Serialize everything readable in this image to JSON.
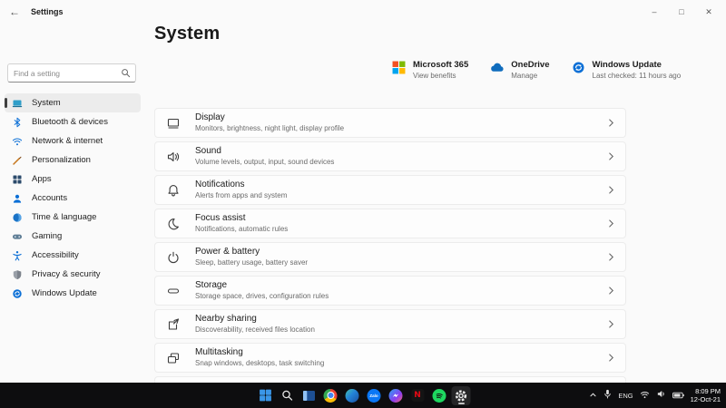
{
  "window": {
    "title": "Settings",
    "back_glyph": "←",
    "controls": {
      "minimize": "–",
      "maximize": "□",
      "close": "✕"
    }
  },
  "sidebar": {
    "search_placeholder": "Find a setting",
    "items": [
      {
        "label": "System",
        "icon": "laptop",
        "selected": true
      },
      {
        "label": "Bluetooth & devices",
        "icon": "bluetooth",
        "selected": false
      },
      {
        "label": "Network & internet",
        "icon": "wifi",
        "selected": false
      },
      {
        "label": "Personalization",
        "icon": "brush",
        "selected": false
      },
      {
        "label": "Apps",
        "icon": "apps-grid",
        "selected": false
      },
      {
        "label": "Accounts",
        "icon": "person",
        "selected": false
      },
      {
        "label": "Time & language",
        "icon": "clock-globe",
        "selected": false
      },
      {
        "label": "Gaming",
        "icon": "gamepad",
        "selected": false
      },
      {
        "label": "Accessibility",
        "icon": "accessibility-person",
        "selected": false
      },
      {
        "label": "Privacy & security",
        "icon": "shield",
        "selected": false
      },
      {
        "label": "Windows Update",
        "icon": "update-arrows",
        "selected": false
      }
    ]
  },
  "main": {
    "page_title": "System",
    "quick_cards": [
      {
        "title": "Microsoft 365",
        "subtitle": "View benefits",
        "icon": "microsoft-logo"
      },
      {
        "title": "OneDrive",
        "subtitle": "Manage",
        "icon": "onedrive-cloud"
      },
      {
        "title": "Windows Update",
        "subtitle": "Last checked: 11 hours ago",
        "icon": "windows-update"
      }
    ],
    "settings_list": [
      {
        "title": "Display",
        "subtitle": "Monitors, brightness, night light, display profile",
        "icon": "display"
      },
      {
        "title": "Sound",
        "subtitle": "Volume levels, output, input, sound devices",
        "icon": "speaker"
      },
      {
        "title": "Notifications",
        "subtitle": "Alerts from apps and system",
        "icon": "bell"
      },
      {
        "title": "Focus assist",
        "subtitle": "Notifications, automatic rules",
        "icon": "moon"
      },
      {
        "title": "Power & battery",
        "subtitle": "Sleep, battery usage, battery saver",
        "icon": "power"
      },
      {
        "title": "Storage",
        "subtitle": "Storage space, drives, configuration rules",
        "icon": "drive"
      },
      {
        "title": "Nearby sharing",
        "subtitle": "Discoverability, received files location",
        "icon": "share"
      },
      {
        "title": "Multitasking",
        "subtitle": "Snap windows, desktops, task switching",
        "icon": "windows-stack"
      }
    ]
  },
  "taskbar": {
    "apps": [
      "start",
      "search",
      "task-view",
      "chrome",
      "edge",
      "zalo",
      "messenger",
      "netflix",
      "spotify",
      "settings"
    ],
    "active_app": "settings",
    "zalo_label": "Zalo",
    "netflix_letter": "N",
    "tray": {
      "language": "ENG",
      "time": "8:09 PM",
      "date": "12-Oct-21"
    }
  },
  "colors": {
    "accent_indicator": "#3f3f3f",
    "selected_item_bg": "#ececec",
    "card_bg": "#fdfdfd",
    "card_border": "#ececec",
    "taskbar_bg": "#0d0d0f",
    "ms_red": "#f25022",
    "ms_green": "#7fba00",
    "ms_blue": "#00a4ef",
    "ms_yellow": "#ffb900",
    "onedrive_blue": "#0f6cbd",
    "update_blue": "#0b6fd6"
  }
}
